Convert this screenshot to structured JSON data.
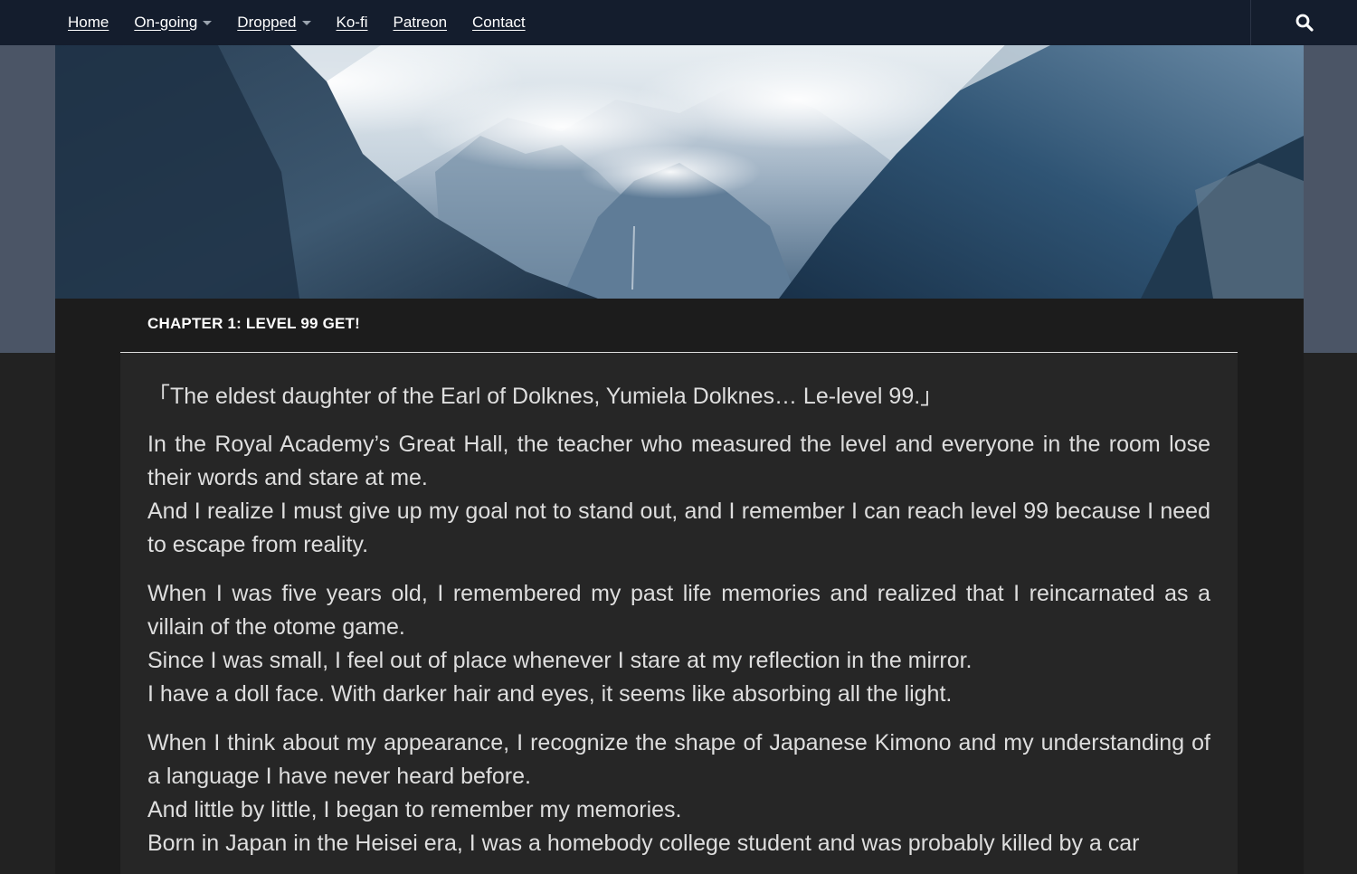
{
  "nav": {
    "items": [
      {
        "label": "Home",
        "dropdown": false
      },
      {
        "label": "On-going",
        "dropdown": true
      },
      {
        "label": "Dropped",
        "dropdown": true
      },
      {
        "label": "Ko-fi",
        "dropdown": false
      },
      {
        "label": "Patreon",
        "dropdown": false
      },
      {
        "label": "Contact",
        "dropdown": false
      }
    ],
    "search_icon": "search-icon"
  },
  "header_image": {
    "icon": "mountain-landscape"
  },
  "chapter": {
    "title": "CHAPTER 1: LEVEL 99 GET!",
    "paragraphs": [
      [
        "「The eldest daughter of the Earl of Dolknes, Yumiela Dolknes… Le-level 99.」"
      ],
      [
        "In the Royal Academy’s Great Hall, the teacher who measured the level and everyone in the room lose their words and stare at me.",
        "And I realize I must give up my goal not to stand out, and I remember I can reach level 99 because I need to escape from reality."
      ],
      [
        "When I was five years old, I remembered my past life memories and realized that I reincarnated as a villain of the otome game.",
        "Since I was small, I feel out of place whenever I stare at my reflection in the mirror.",
        "I have a doll face. With darker hair and eyes, it seems like absorbing all the light."
      ],
      [
        "When I think about my appearance, I recognize the shape of Japanese Kimono and my understanding of a language I have never heard before.",
        "And little by little, I began to remember my memories.",
        "Born in Japan in the Heisei era, I was a homebody college student and was probably killed by a car"
      ]
    ]
  },
  "colors": {
    "topbar": "#141d2d",
    "band": "#4b5566",
    "page": "#222222",
    "content": "#262626",
    "text": "#dedede"
  }
}
